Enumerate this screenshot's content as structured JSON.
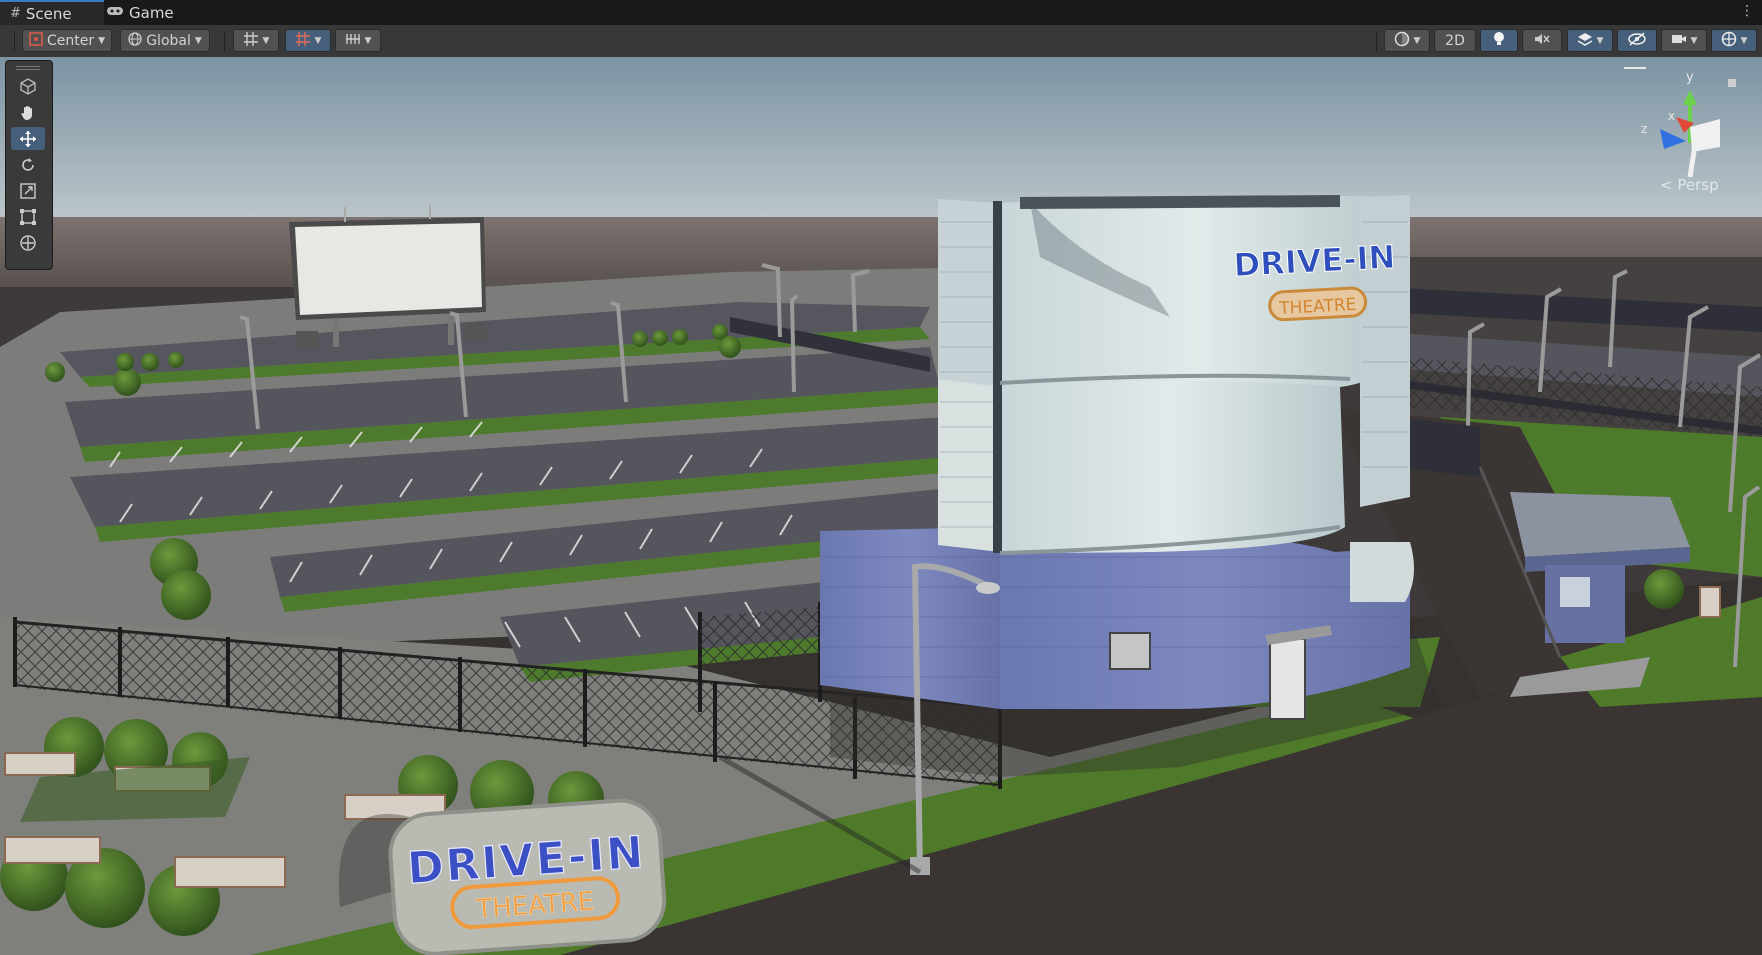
{
  "tabs": [
    {
      "label": "Scene",
      "icon": "grid-icon"
    },
    {
      "label": "Game",
      "icon": "gamepad-icon"
    }
  ],
  "toolbar": {
    "pivot_label": "Center",
    "space_label": "Global",
    "mode_2d_label": "2D"
  },
  "tools": [
    "view-tool",
    "hand-tool",
    "move-tool",
    "rotate-tool",
    "scale-tool",
    "rect-tool",
    "transform-tool"
  ],
  "active_tool": "move-tool",
  "gizmo": {
    "y_label": "y",
    "x_label": "x",
    "z_label": "z",
    "projection_label": "Persp"
  },
  "signs": {
    "roadside_main": "DRIVE-IN",
    "roadside_sub": "THEATRE",
    "building_main": "DRIVE-IN",
    "building_sub": "THEATRE"
  },
  "colors": {
    "accent": "#3a79bb",
    "sky_top": "#7f96a3",
    "ground": "#3a3635",
    "grass": "#4f7a2a",
    "neon_blue": "#3050c8",
    "neon_orange": "#f0a040"
  }
}
